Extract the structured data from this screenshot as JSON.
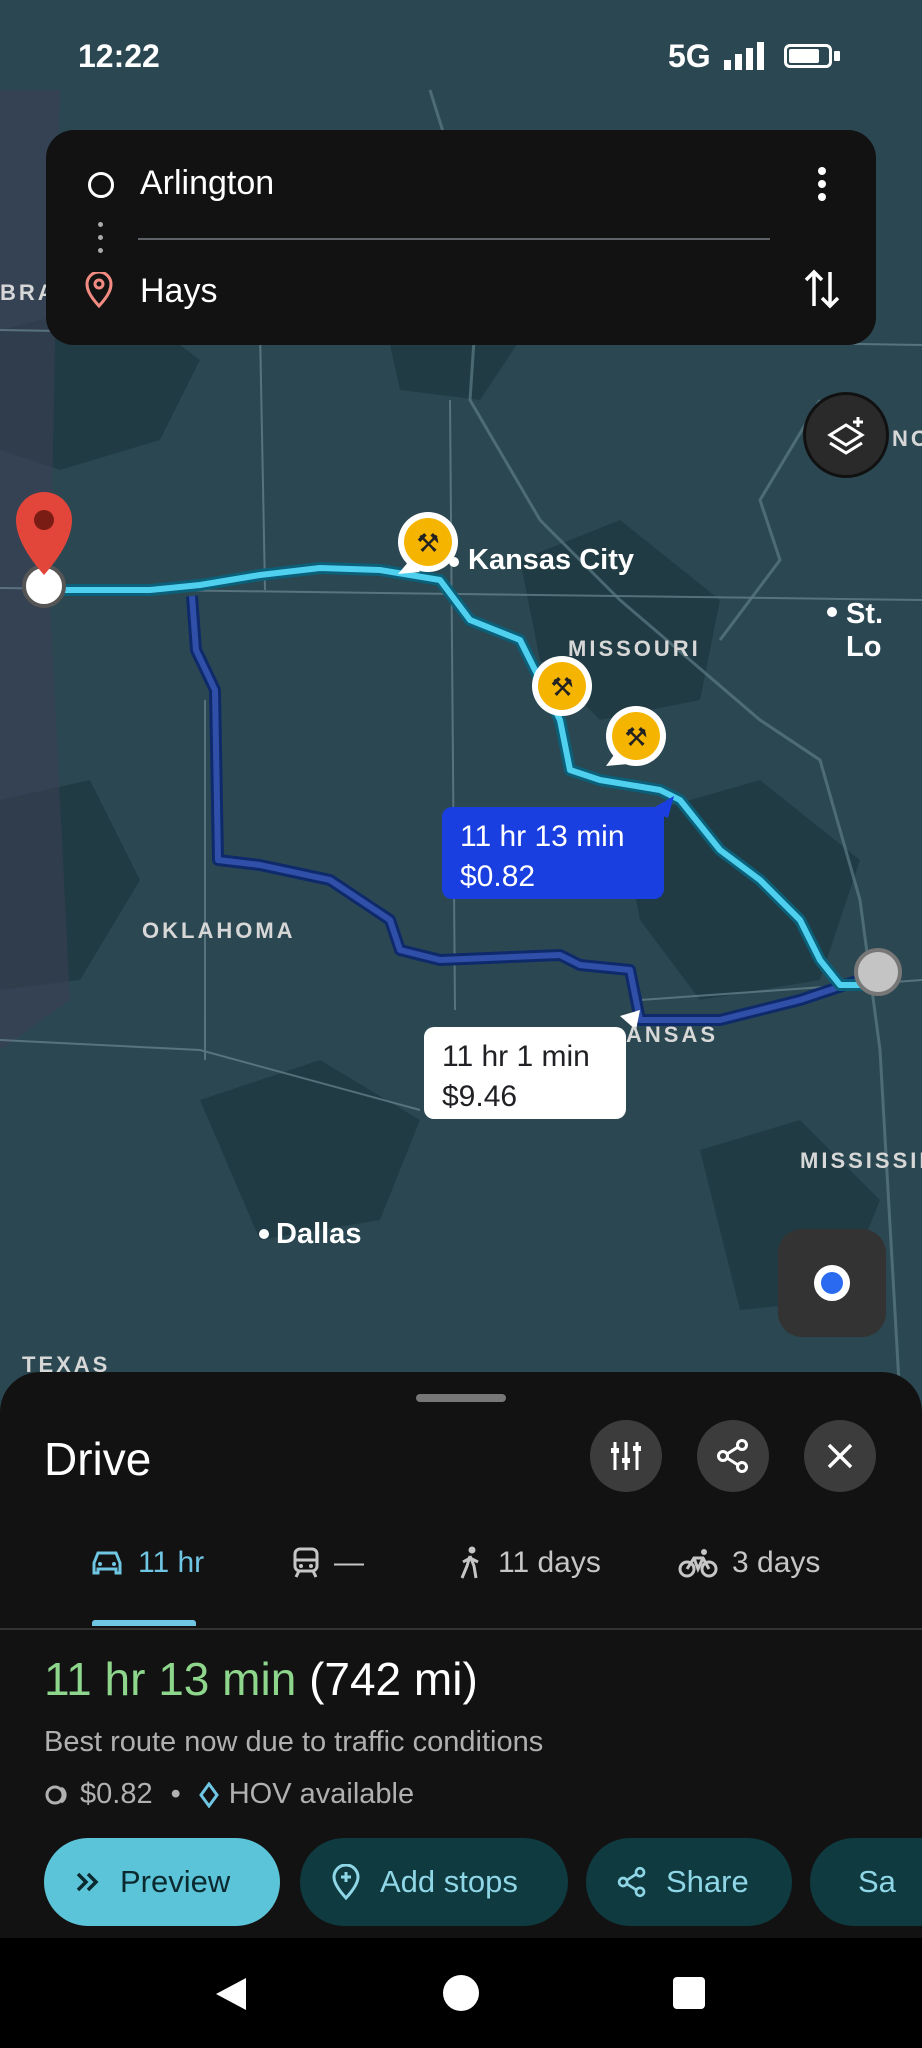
{
  "status": {
    "time": "12:22",
    "network": "5G"
  },
  "search": {
    "origin": "Arlington",
    "destination": "Hays"
  },
  "map": {
    "labels": {
      "kansas_city": "Kansas City",
      "st_louis": "St. Lo",
      "dallas": "Dallas",
      "missouri": "MISSOURI",
      "oklahoma": "OKLAHOMA",
      "arkansas": "ANSAS",
      "mississippi": "MISSISSIP",
      "texas": "TEXAS",
      "nebraska": "BRA",
      "no": "NO"
    },
    "routes": {
      "primary": {
        "time": "11 hr 13 min",
        "toll": "$0.82"
      },
      "alternate": {
        "time": "11 hr 1 min",
        "toll": "$9.46"
      }
    }
  },
  "sheet": {
    "title": "Drive",
    "tabs": [
      {
        "label": "11 hr"
      },
      {
        "label": "—"
      },
      {
        "label": "11 days"
      },
      {
        "label": "3 days"
      }
    ],
    "summary": {
      "duration": "11 hr 13 min",
      "distance": "(742 mi)",
      "note": "Best route now due to traffic conditions",
      "toll": "$0.82",
      "hov": "HOV available"
    },
    "actions": {
      "preview": "Preview",
      "add_stops": "Add stops",
      "share": "Share",
      "save": "Sa"
    }
  },
  "colors": {
    "route_primary": "#4fd0ef",
    "route_alternate": "#2f4fa8",
    "accent": "#6fc6e3",
    "time_green": "#8ed68c",
    "pin_red": "#e2463a",
    "construction": "#f4b400"
  }
}
